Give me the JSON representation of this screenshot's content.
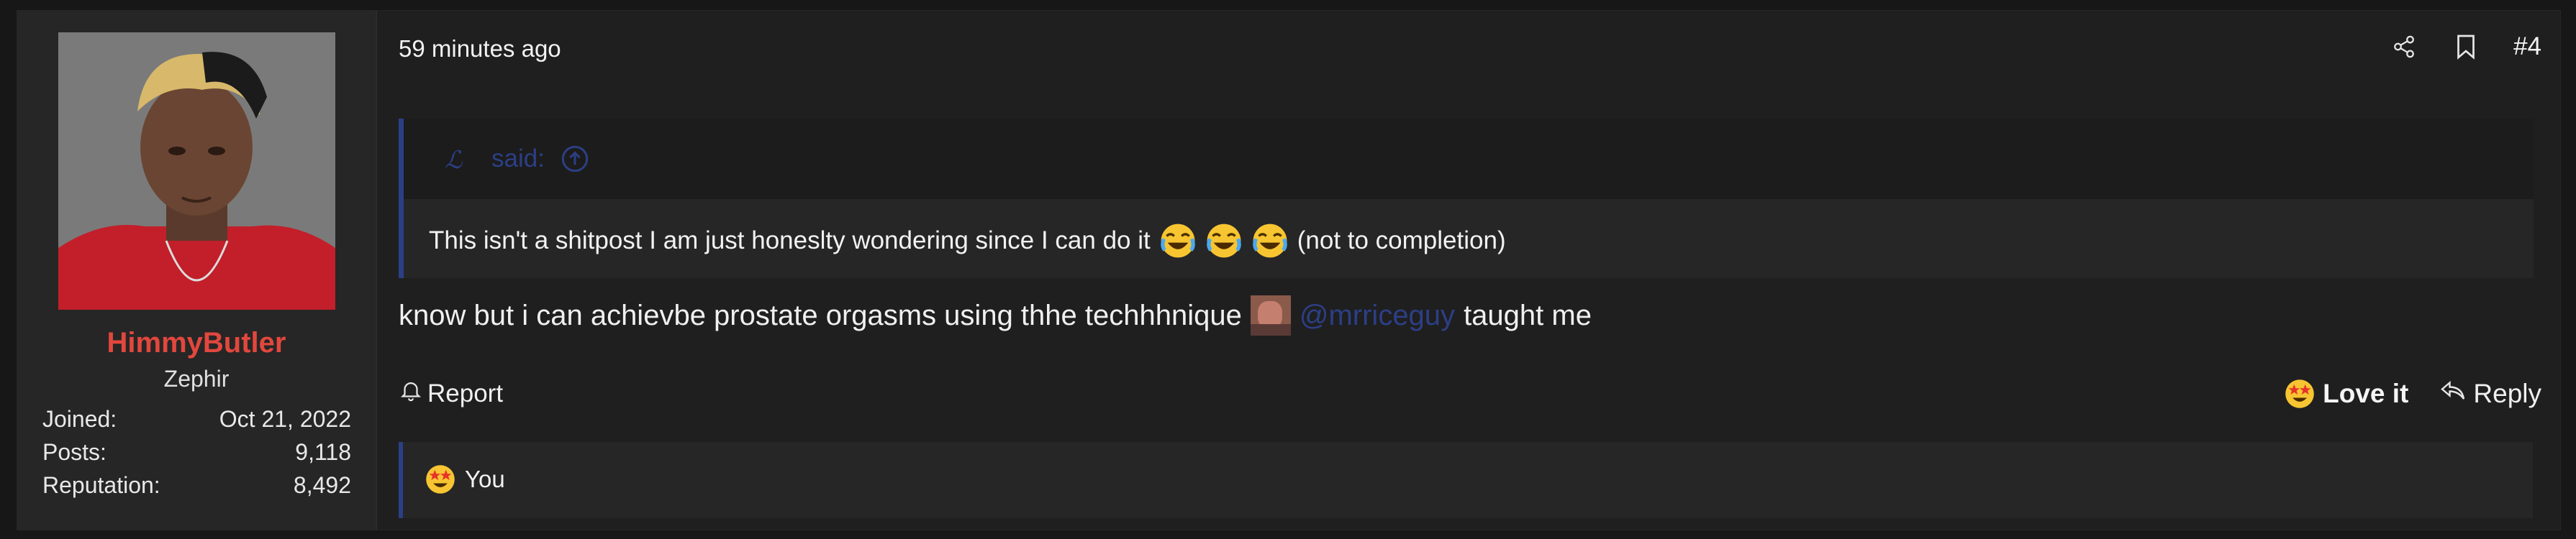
{
  "user": {
    "name": "HimmyButler",
    "title": "Zephir",
    "stats": [
      {
        "key": "Joined:",
        "value": "Oct 21, 2022"
      },
      {
        "key": "Posts:",
        "value": "9,118"
      },
      {
        "key": "Reputation:",
        "value": "8,492"
      }
    ]
  },
  "post": {
    "time": "59 minutes ago",
    "number": "#4",
    "quote": {
      "author_symbol": "ℒ",
      "said": "said:",
      "text": "This isn't a shitpost I am just honeslty wondering since I can do it",
      "suffix": "(not to completion)"
    },
    "message": {
      "before": "know but i can achievbe prostate orgasms using thhe techhhnique",
      "mention": "@mrriceguy",
      "after": "taught me"
    },
    "actions": {
      "report": "Report",
      "love": "Love it",
      "reply": "Reply"
    },
    "reactions": {
      "who": "You"
    }
  },
  "icons": {
    "share": "share-icon",
    "bookmark": "bookmark-icon",
    "bell": "bell-icon",
    "reply": "reply-icon",
    "arrow_up": "arrow-up-circle-icon",
    "joy": "joy-emoji",
    "star_struck": "star-struck-emoji"
  },
  "colors": {
    "username": "#e2473d",
    "accent": "#2c3f86",
    "background": "#1f1f1f"
  }
}
